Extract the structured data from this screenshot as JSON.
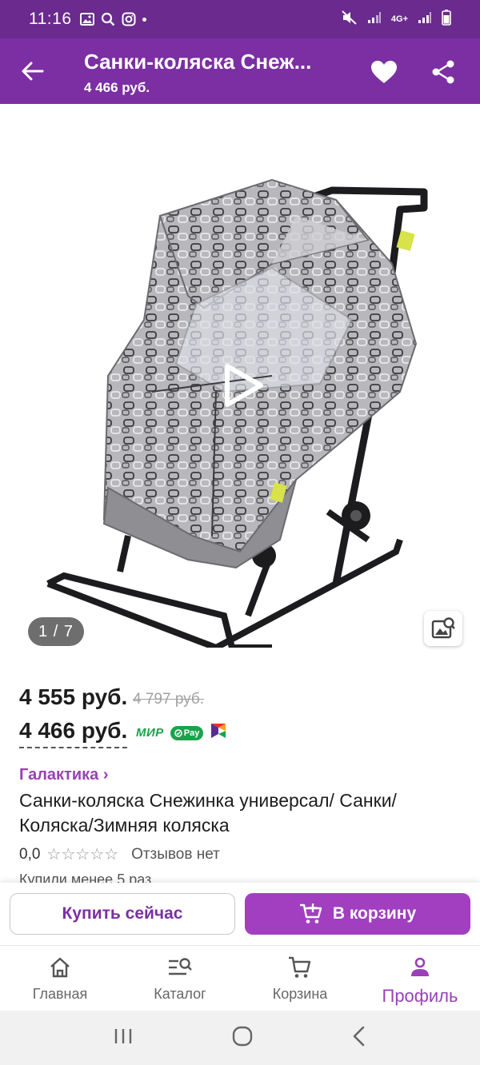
{
  "status_bar": {
    "time": "11:16",
    "network": "4G+",
    "icons": [
      "image-icon",
      "search-icon",
      "instagram-icon",
      "mute-icon",
      "signal-icon",
      "battery-icon"
    ]
  },
  "app_bar": {
    "title": "Санки-коляска Снеж...",
    "subtitle": "4 466 руб."
  },
  "gallery": {
    "counter": "1 / 7"
  },
  "price": {
    "current": "4 555 руб.",
    "old": "4 797 руб.",
    "card": "4 466 руб.",
    "mir": "МИР",
    "gpay": "Pay"
  },
  "product": {
    "brand": "Галактика ›",
    "title": "Санки-коляска Снежинка универсал/ Санки/ Коляска/Зимняя коляска",
    "rating": "0,0",
    "stars": "☆☆☆☆☆",
    "reviews": "Отзывов нет",
    "purchased": "Купили менее 5 раз"
  },
  "actions": {
    "buy_now": "Купить сейчас",
    "add_to_cart": "В корзину"
  },
  "bottom_nav": {
    "home": "Главная",
    "catalog": "Каталог",
    "cart": "Корзина",
    "profile": "Профиль"
  },
  "colors": {
    "status_bar": "#6a2a8e",
    "app_bar": "#7b2fa2",
    "accent": "#a13fc0",
    "active_nav": "#9b3fb8"
  }
}
